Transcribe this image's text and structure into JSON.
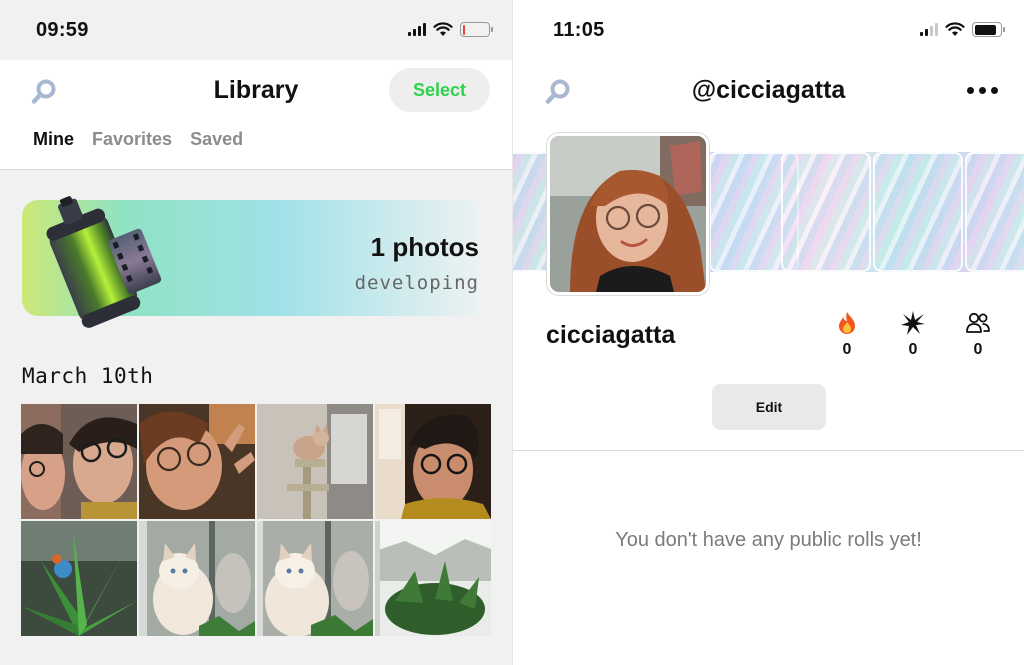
{
  "left_screen": {
    "status_bar": {
      "time": "09:59",
      "battery_color": "#e8453c",
      "battery_level": 0.1
    },
    "header": {
      "search_icon": "search-icon",
      "title": "Library",
      "select_label": "Select",
      "select_color": "#2bd24a"
    },
    "tabs": [
      {
        "label": "Mine",
        "active": true
      },
      {
        "label": "Favorites",
        "active": false
      },
      {
        "label": "Saved",
        "active": false
      }
    ],
    "developing_card": {
      "icon": "film-roll-icon",
      "count_text": "1 photos",
      "status_text": "developing"
    },
    "sections": [
      {
        "date": "March 10th",
        "photos": [
          "couple-selfie-photo",
          "woman-glasses-photo",
          "cat-on-tree-photo",
          "man-glasses-photo",
          "aloe-plant-photo",
          "white-cat-photo",
          "white-cat-photo-2",
          "window-plant-photo"
        ]
      }
    ]
  },
  "right_screen": {
    "status_bar": {
      "time": "11:05",
      "battery_color": "#111111",
      "battery_level": 0.85
    },
    "header": {
      "search_icon": "search-icon",
      "title": "@cicciagatta",
      "more_icon": "more-icon"
    },
    "profile": {
      "avatar": "profile-avatar-photo",
      "username": "cicciagatta",
      "stats": [
        {
          "icon": "flame-icon",
          "value": "0"
        },
        {
          "icon": "sparkle-burst-icon",
          "value": "0"
        },
        {
          "icon": "people-icon",
          "value": "0"
        }
      ],
      "edit_label": "Edit"
    },
    "empty_message": "You don't have any public rolls yet!"
  }
}
